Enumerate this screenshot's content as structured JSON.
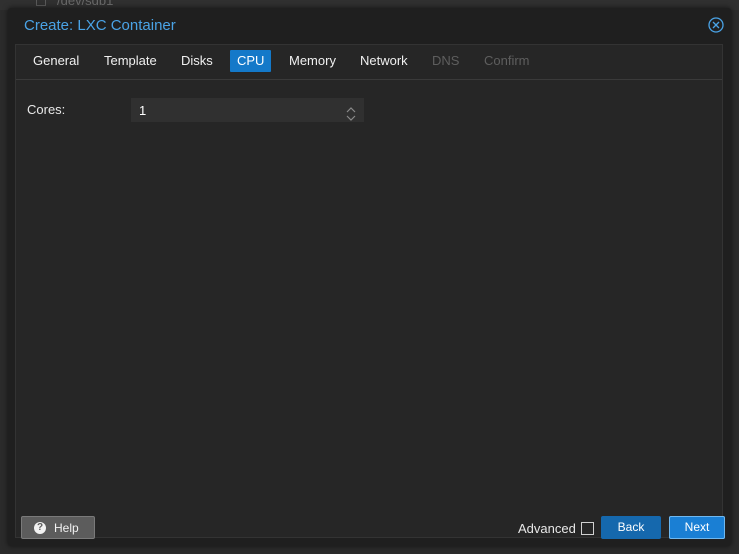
{
  "background": {
    "partial_text": "/dev/sdb1"
  },
  "window": {
    "title": "Create: LXC Container",
    "close_icon": "close-circle-icon",
    "accent_color": "#4aa3e6"
  },
  "tabs": [
    {
      "label": "General",
      "state": "normal"
    },
    {
      "label": "Template",
      "state": "normal"
    },
    {
      "label": "Disks",
      "state": "normal"
    },
    {
      "label": "CPU",
      "state": "active"
    },
    {
      "label": "Memory",
      "state": "normal"
    },
    {
      "label": "Network",
      "state": "normal"
    },
    {
      "label": "DNS",
      "state": "disabled"
    },
    {
      "label": "Confirm",
      "state": "disabled"
    }
  ],
  "form": {
    "cores_label": "Cores:",
    "cores_value": "1"
  },
  "footer": {
    "help_label": "Help",
    "help_icon": "question-circle-icon",
    "advanced_label": "Advanced",
    "advanced_checked": false,
    "back_label": "Back",
    "next_label": "Next"
  },
  "colors": {
    "active_tab": "#1479c9",
    "primary_button": "#1a7fd4",
    "secondary_button": "#1568ad"
  }
}
